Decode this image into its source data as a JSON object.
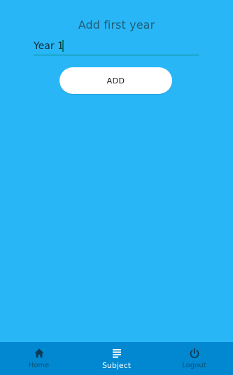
{
  "page": {
    "title": "Add first year"
  },
  "form": {
    "year_value": "Year 1"
  },
  "actions": {
    "add_label": "ADD"
  },
  "bottom_nav": {
    "items": [
      {
        "label": "Home",
        "icon": "home-icon",
        "active": false
      },
      {
        "label": "Subject",
        "icon": "list-icon",
        "active": true
      },
      {
        "label": "Logout",
        "icon": "power-icon",
        "active": false
      }
    ]
  },
  "colors": {
    "background": "#29b6f6",
    "nav_background": "#0288d1",
    "input_underline": "#00897b",
    "button_background": "#ffffff"
  }
}
